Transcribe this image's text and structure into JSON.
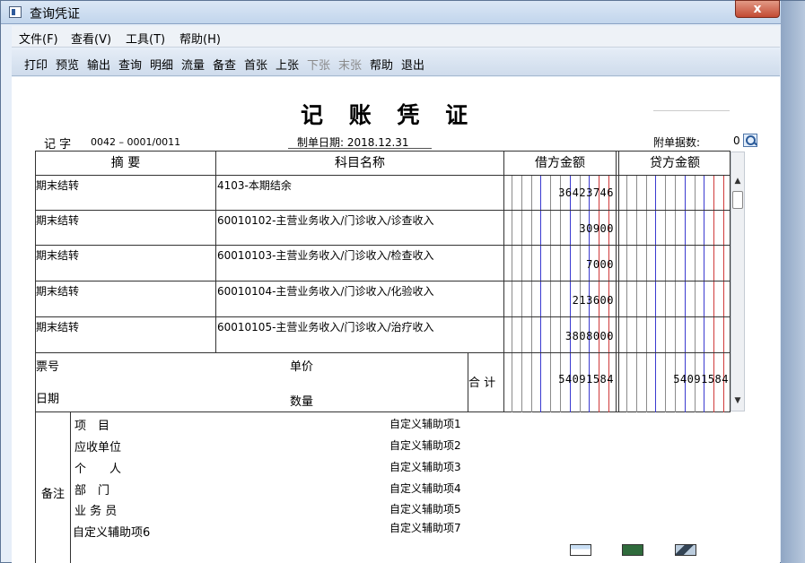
{
  "window": {
    "title": "查询凭证",
    "close_label": "x"
  },
  "menu": [
    "文件(F)",
    "查看(V)",
    "工具(T)",
    "帮助(H)"
  ],
  "toolbar": [
    {
      "label": "打印",
      "enabled": true
    },
    {
      "label": "预览",
      "enabled": true
    },
    {
      "label": "输出",
      "enabled": true
    },
    {
      "label": "查询",
      "enabled": true
    },
    {
      "label": "明细",
      "enabled": true
    },
    {
      "label": "流量",
      "enabled": true
    },
    {
      "label": "备查",
      "enabled": true
    },
    {
      "label": "首张",
      "enabled": true
    },
    {
      "label": "上张",
      "enabled": true
    },
    {
      "label": "下张",
      "enabled": false
    },
    {
      "label": "末张",
      "enabled": false
    },
    {
      "label": "帮助",
      "enabled": true
    },
    {
      "label": "退出",
      "enabled": true
    }
  ],
  "voucher": {
    "title": "记 账 凭 证",
    "type_label": "记 字",
    "number": "0042 –  0001/0011",
    "date_label": "制单日期: 2018.12.31",
    "attachments_label": "附单据数:",
    "attachments_value": "0",
    "columns": {
      "summary": "摘 要",
      "account": "科目名称",
      "debit": "借方金额",
      "credit": "贷方金额"
    },
    "rows": [
      {
        "summary": "期末结转",
        "account": "4103-本期结余",
        "debit": "36423746",
        "credit": ""
      },
      {
        "summary": "期末结转",
        "account": "60010102-主营业务收入/门诊收入/诊查收入",
        "debit": "30900",
        "credit": ""
      },
      {
        "summary": "期末结转",
        "account": "60010103-主营业务收入/门诊收入/检查收入",
        "debit": "7000",
        "credit": ""
      },
      {
        "summary": "期末结转",
        "account": "60010104-主营业务收入/门诊收入/化验收入",
        "debit": "213600",
        "credit": ""
      },
      {
        "summary": "期末结转",
        "account": "60010105-主营业务收入/门诊收入/治疗收入",
        "debit": "3808000",
        "credit": ""
      }
    ],
    "footer": {
      "ticket_label": "票号",
      "date_label": "日期",
      "price_label": "单价",
      "qty_label": "数量",
      "total_label": "合 计",
      "total_debit": "54091584",
      "total_credit": "54091584"
    },
    "remarks": {
      "label": "备注",
      "left": [
        "项　目",
        "应收单位",
        "个　　人",
        "部　门",
        "业 务 员",
        "自定义辅助项6"
      ],
      "right": [
        "自定义辅助项1",
        "自定义辅助项2",
        "自定义辅助项3",
        "自定义辅助项4",
        "自定义辅助项5",
        "自定义辅助项7"
      ]
    }
  }
}
